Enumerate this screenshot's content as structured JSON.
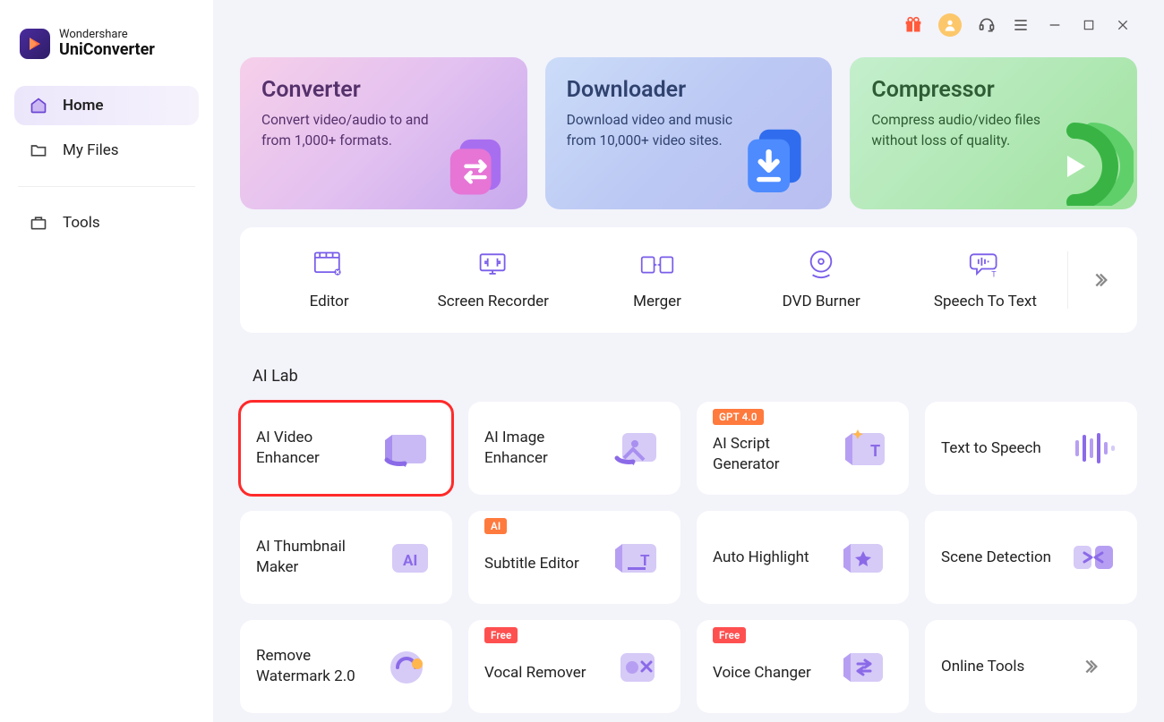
{
  "brand": {
    "top": "Wondershare",
    "bottom": "UniConverter"
  },
  "sidebar": {
    "items": [
      {
        "label": "Home"
      },
      {
        "label": "My Files"
      },
      {
        "label": "Tools"
      }
    ]
  },
  "hero": {
    "converter": {
      "title": "Converter",
      "desc": "Convert video/audio to and from 1,000+ formats."
    },
    "downloader": {
      "title": "Downloader",
      "desc": "Download video and music from 10,000+ video sites."
    },
    "compressor": {
      "title": "Compressor",
      "desc": "Compress audio/video files without loss of quality."
    }
  },
  "tools": {
    "items": [
      {
        "label": "Editor"
      },
      {
        "label": "Screen Recorder"
      },
      {
        "label": "Merger"
      },
      {
        "label": "DVD Burner"
      },
      {
        "label": "Speech To Text"
      }
    ]
  },
  "ailab": {
    "title": "AI Lab",
    "row1": [
      {
        "label": "AI Video Enhancer"
      },
      {
        "label": "AI Image Enhancer"
      },
      {
        "label": "AI Script Generator",
        "badge": "GPT 4.0"
      },
      {
        "label": "Text to Speech"
      }
    ],
    "row2": [
      {
        "label": "AI Thumbnail Maker"
      },
      {
        "label": "Subtitle Editor",
        "badge": "AI"
      },
      {
        "label": "Auto Highlight"
      },
      {
        "label": "Scene Detection"
      }
    ],
    "row3": [
      {
        "label": "Remove Watermark 2.0"
      },
      {
        "label": "Vocal Remover",
        "badge": "Free"
      },
      {
        "label": "Voice Changer",
        "badge": "Free"
      },
      {
        "label": "Online Tools"
      }
    ]
  }
}
